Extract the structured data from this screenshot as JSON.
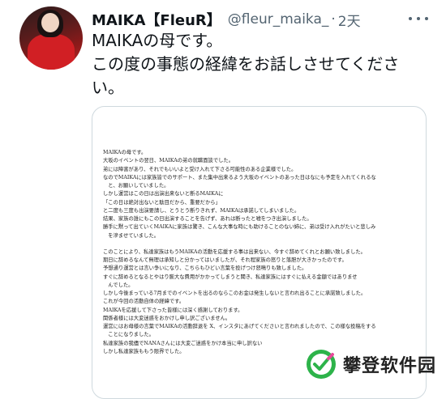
{
  "tweet": {
    "display_name": "MAIKA【FleuR】",
    "handle": "@fleur_maika_",
    "separator": "·",
    "time": "2天",
    "text_lines": [
      "MAIKAの母です。",
      "この度の事態の経緯をお話しさせてくださ",
      "い。"
    ]
  },
  "document": {
    "lines_1": [
      "MAIKAの母です。",
      "大坂のイベントの翌日、MAIKAの弟の就職面談でした。",
      "弟には障害があり、それでもいいよと受け入れて下さる可能性のある企業様でした。",
      "なのでMAIKAには家族皆でのサポート、また集中出来るよう大坂のイベントのあった日はなにも予定を入れてくれるな",
      "　と、お願いしていました。",
      "しかし運営はこの日は出演出来ないと断るMAIKAに",
      "「この日は絶対出ないと駄目だから、重要だから」",
      "と二度も三度も出演要請し、とうとう断りきれず、MAIKAは承諾してしまいました。",
      "結果、家族の誰にもこの日出演することを告げず、あれは断ったと嘘をつき出演しました。",
      "勝手に黙って出ていくMAIKAに家族は驚き、こんな大事な時にも助けることのない姉に、弟は受け入れがたいと悲しみ",
      "　を滲ませていました。"
    ],
    "lines_2": [
      "このことにより、私達家族はもうMAIKAの活動を応援する事は出来ない、今すぐ辞めてくれとお願い致しました。",
      "期日に辞めるなんて無理は承知しと分かってはいましたが、それ程家族の怒りと落胆が大きかったのです。",
      "予想通り運営とは言い争いになり、こちらもひどい言葉を投げつけ怒鳴りも致しました。",
      "すぐに辞めるとなるとやはり膨大な費用がかかってしまうと聞き、私達家族にはすぐに払える金額ではありませ",
      "　んでした。",
      "しかし今後まっている7月までのイベントを出るのならこのお金は発生しないと言われ出ることに承諾致しました。",
      "これが今回の活動自体の経緯です。",
      "MAIKAを応援して下さった皆様には深く感謝しております。",
      "関係者様には大変迷惑をおかけし申し訳ございません。",
      "運営にはお母様の言葉でMAIKAの活動辞退を X、インスタにあげてくださいと言われましたので、この様な投稿をする",
      "　ことになりました。",
      "私達家族の我儘でNANAさんには大変ご迷惑をかけ本当に申し訳ない",
      "しかし私達家族ももう限界でした。"
    ]
  },
  "watermark": {
    "text": "攀登软件园"
  }
}
